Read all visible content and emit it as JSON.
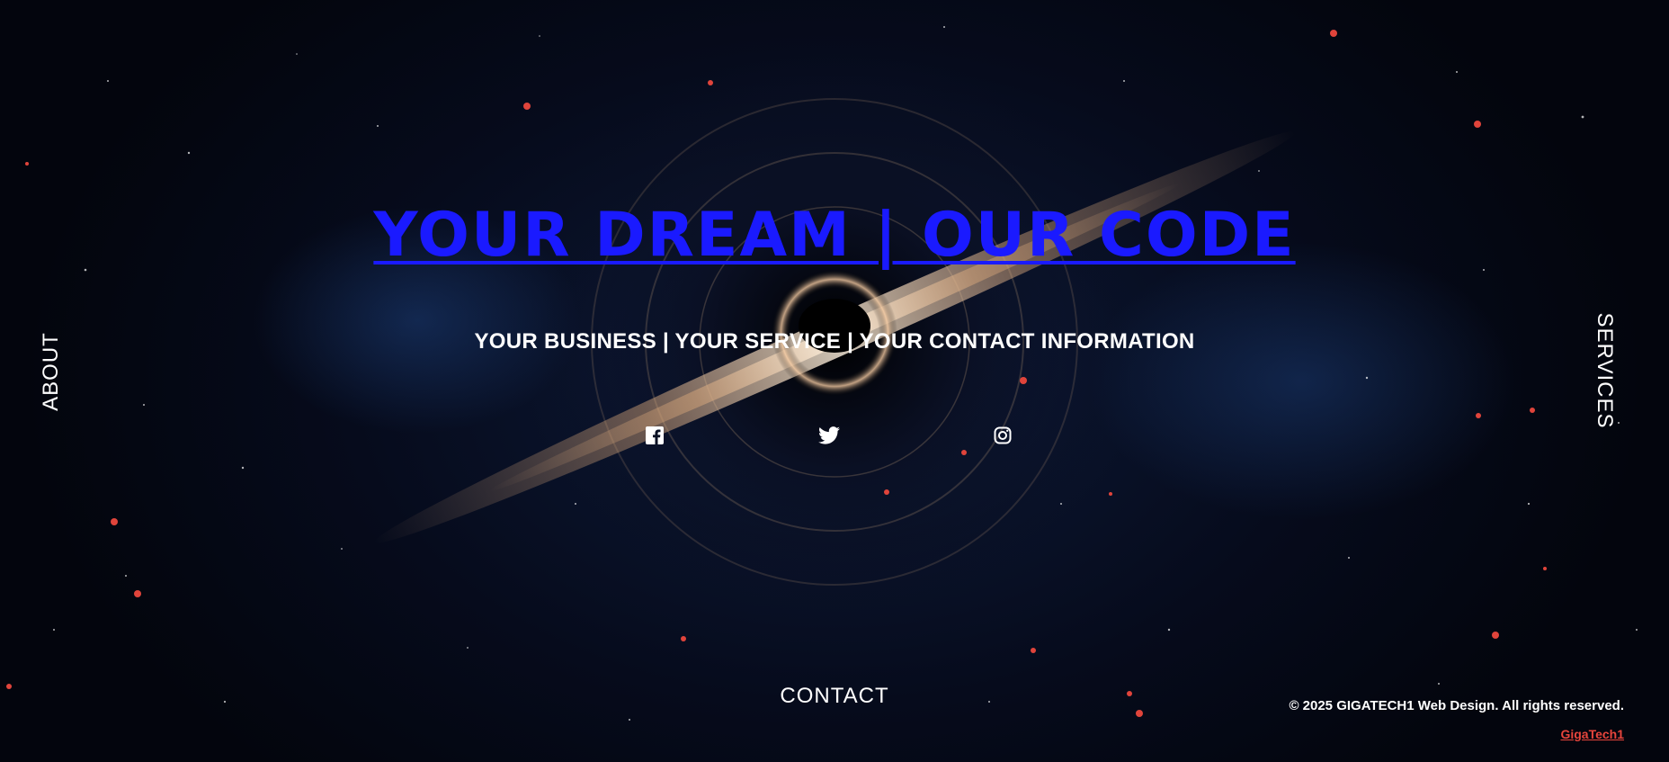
{
  "hero": {
    "headline": "YOUR DREAM | OUR CODE",
    "tagline": "YOUR BUSINESS | YOUR SERVICE | YOUR CONTACT INFORMATION"
  },
  "social": [
    {
      "name": "facebook",
      "icon": "facebook-icon"
    },
    {
      "name": "twitter",
      "icon": "twitter-icon"
    },
    {
      "name": "instagram",
      "icon": "instagram-icon"
    }
  ],
  "nav": {
    "about": "ABOUT",
    "services": "SERVICES",
    "contact": "CONTACT"
  },
  "footer": {
    "copyright": "© 2025 GIGATECH1 Web Design. All rights reserved.",
    "credit": "GigaTech1"
  },
  "colors": {
    "headline": "#1a1aff",
    "text": "#ffffff",
    "credit": "#e8453c",
    "background": "#060b1c"
  }
}
